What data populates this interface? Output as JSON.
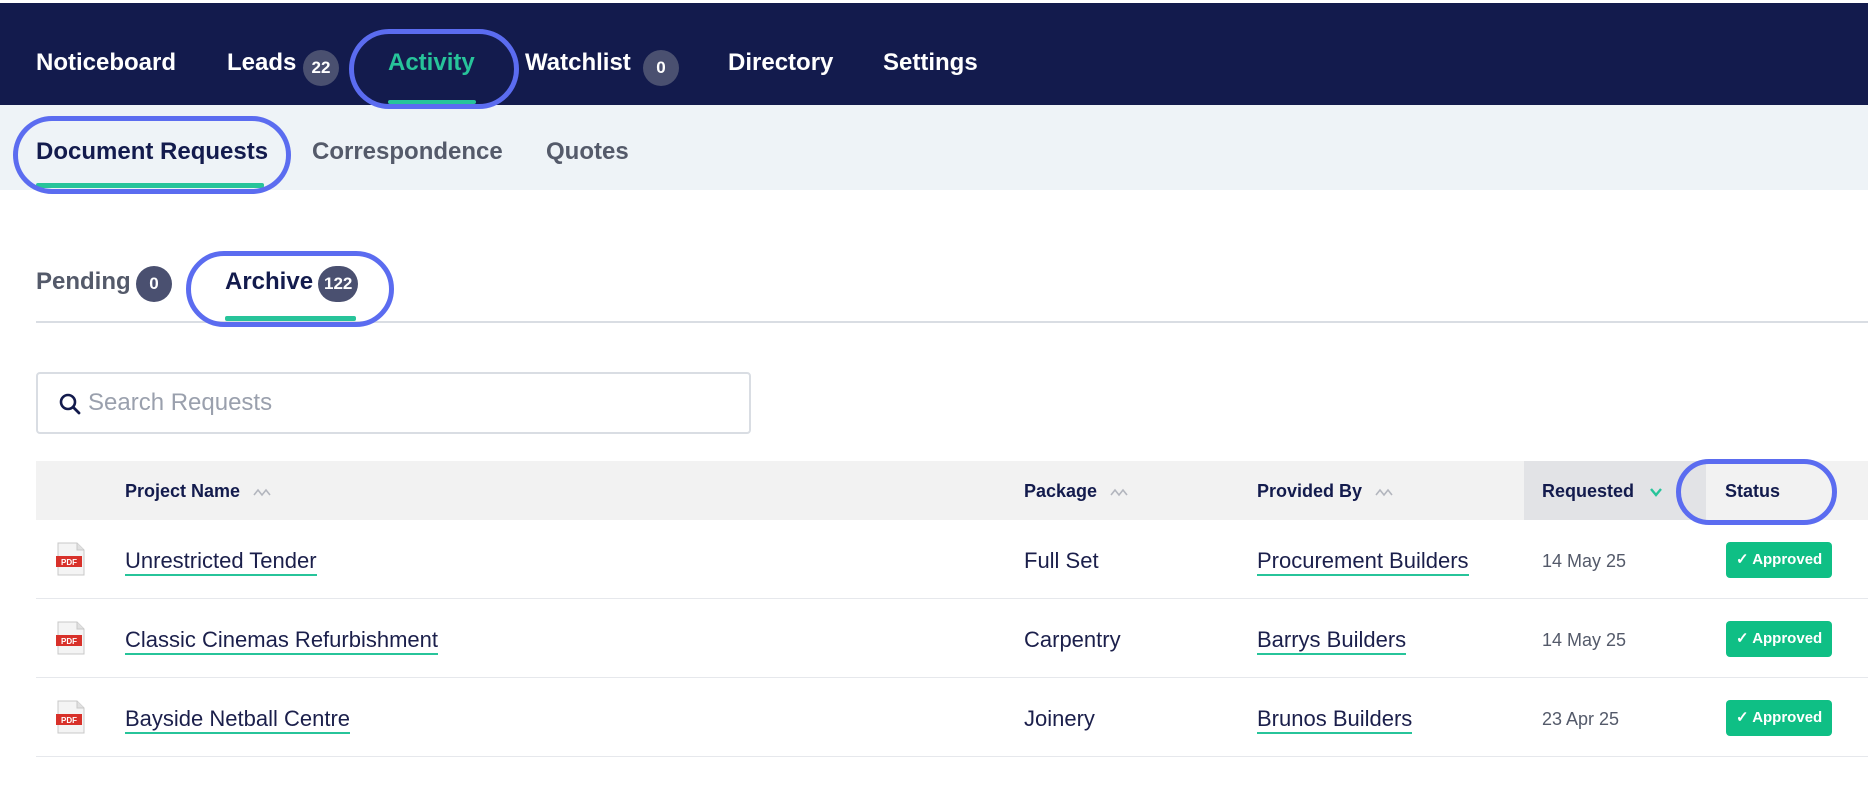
{
  "topnav": {
    "items": [
      {
        "label": "Noticeboard"
      },
      {
        "label": "Leads",
        "badge": "22"
      },
      {
        "label": "Activity"
      },
      {
        "label": "Watchlist",
        "badge": "0"
      },
      {
        "label": "Directory"
      },
      {
        "label": "Settings"
      }
    ],
    "active": "Activity"
  },
  "subnav": {
    "items": [
      {
        "label": "Document Requests"
      },
      {
        "label": "Correspondence"
      },
      {
        "label": "Quotes"
      }
    ],
    "active": "Document Requests"
  },
  "tabs": {
    "pending": {
      "label": "Pending",
      "count": "0"
    },
    "archive": {
      "label": "Archive",
      "count": "122"
    },
    "active": "Archive"
  },
  "search": {
    "placeholder": "Search Requests",
    "value": ""
  },
  "table": {
    "columns": {
      "project": "Project Name",
      "package": "Package",
      "provided_by": "Provided By",
      "requested": "Requested",
      "status": "Status"
    },
    "sorted_by": "Requested",
    "rows": [
      {
        "project": "Unrestricted Tender",
        "package": "Full Set",
        "provided_by": "Procurement Builders",
        "requested": "14 May 25",
        "status": "Approved"
      },
      {
        "project": "Classic Cinemas Refurbishment",
        "package": "Carpentry",
        "provided_by": "Barrys Builders",
        "requested": "14 May 25",
        "status": "Approved"
      },
      {
        "project": "Bayside Netball Centre",
        "package": "Joinery",
        "provided_by": "Brunos Builders",
        "requested": "23 Apr 25",
        "status": "Approved"
      }
    ]
  },
  "icons": {
    "search": "search-icon",
    "pdf": "pdf-file-icon",
    "sort": "sort-icon",
    "sort_active": "chevron-down-icon",
    "check": "check-icon"
  },
  "colors": {
    "nav_bg": "#131b4d",
    "accent": "#27c49a",
    "status_approved": "#0fbf85",
    "highlight_circle": "#5b6cf0"
  }
}
